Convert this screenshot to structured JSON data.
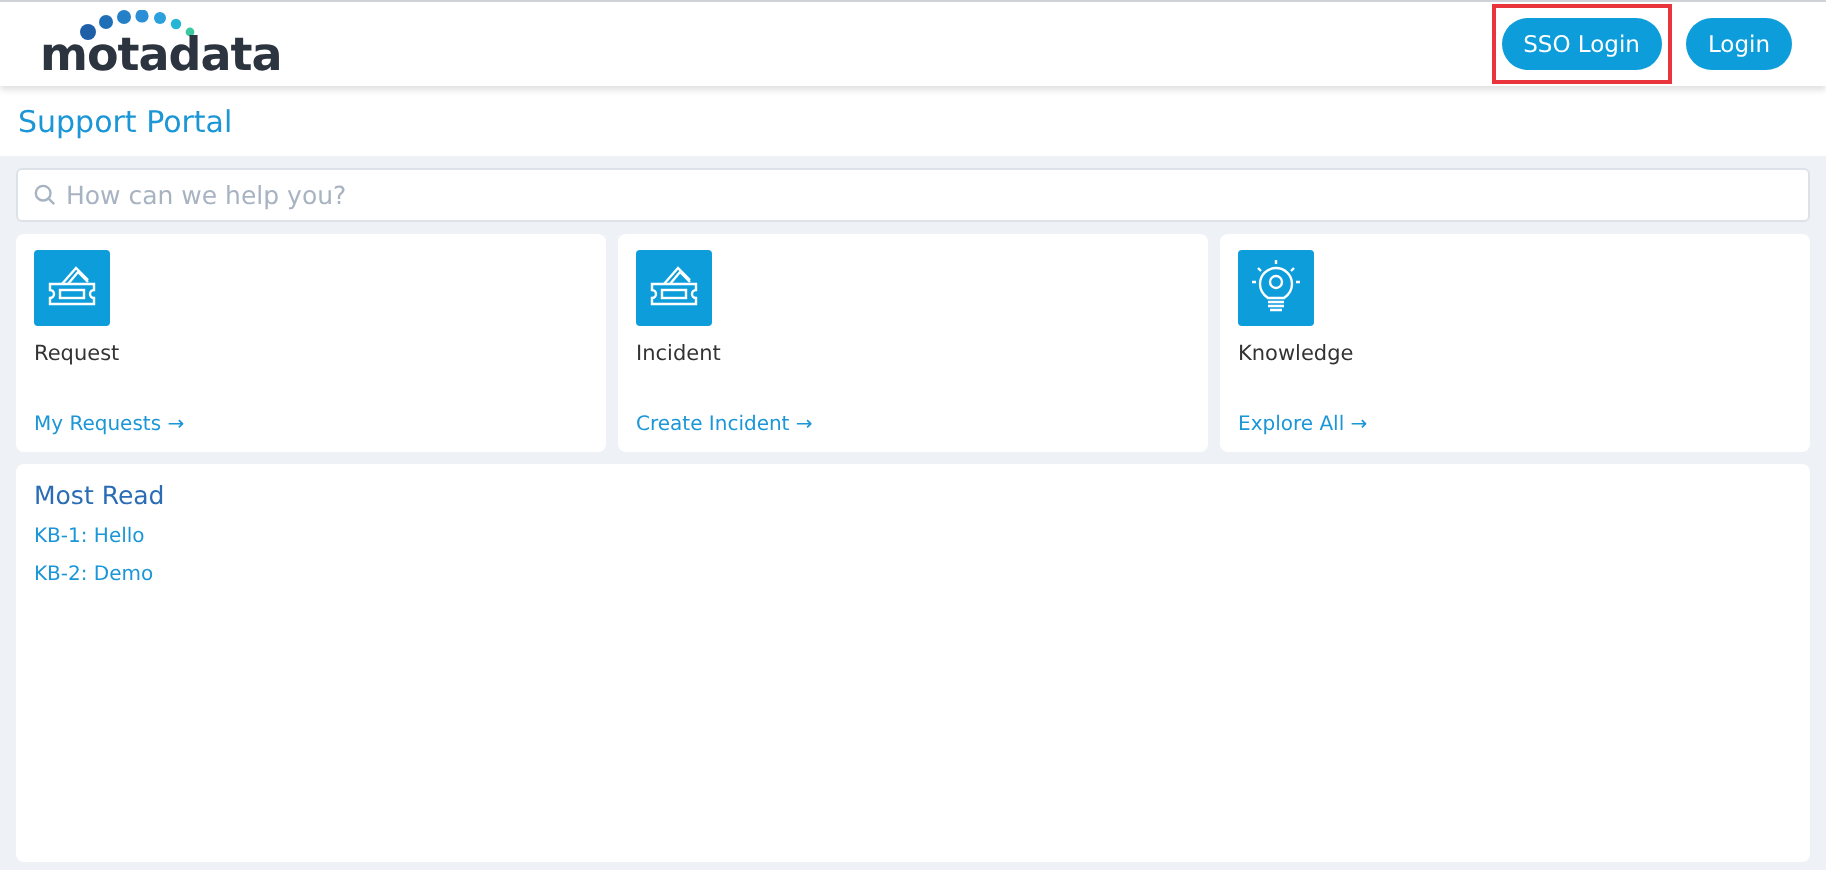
{
  "header": {
    "logo": "motadata",
    "buttons": [
      {
        "label": "SSO Login",
        "highlighted": true
      },
      {
        "label": "Login",
        "highlighted": false
      }
    ]
  },
  "page_title": "Support Portal",
  "search": {
    "placeholder": "How can we help you?"
  },
  "cards": [
    {
      "kind": "ticket",
      "title": "Request",
      "link": "My Requests →"
    },
    {
      "kind": "ticket",
      "title": "Incident",
      "link": "Create Incident →"
    },
    {
      "kind": "bulb",
      "title": "Knowledge",
      "link": "Explore All →"
    }
  ],
  "most_read": {
    "title": "Most Read",
    "items": [
      "KB-1: Hello",
      "KB-2: Demo"
    ]
  }
}
